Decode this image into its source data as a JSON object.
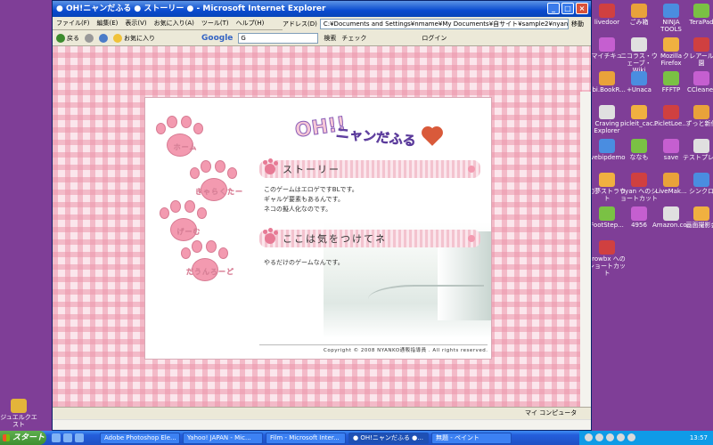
{
  "window": {
    "title": "● OH!ニャンだふる ● ストーリー ● - Microsoft Internet Explorer",
    "buttons": [
      "_",
      "□",
      "×"
    ]
  },
  "menu": [
    "ファイル(F)",
    "編集(E)",
    "表示(V)",
    "お気に入り(A)",
    "ツール(T)",
    "ヘルプ(H)"
  ],
  "address": {
    "label": "アドレス(D)",
    "url": "C:¥Documents and Settings¥nmame¥My Documents¥自サイト¥sample2¥nyan¥story.html",
    "go": "移動"
  },
  "toolbar": {
    "back": "戻る",
    "favorites": "お気に入り",
    "google_logo": "Google",
    "google_value": "G",
    "search": "検索",
    "check": "チェック",
    "login": "ログイン"
  },
  "site": {
    "logo_main": "OH!!",
    "logo_sub": "ニャンだふる",
    "nav": [
      "ホーム",
      "きゃらくたー",
      "げーむ",
      "だうんろーど"
    ],
    "sections": [
      {
        "title": "ストーリー",
        "body": "このゲームはエロゲですBLです。\nギャルゲ要素もあるんです。\nネコの擬人化なのです。"
      },
      {
        "title": "ここは気をつけてネ",
        "body": "やるだけのゲームなんです。"
      }
    ],
    "footer": "Copyright © 2008 NYANKO通販指導員 . All rights reserved."
  },
  "status": {
    "left": "",
    "zone": "マイ コンピュータ"
  },
  "desktop_icons_right": [
    "livedoor",
    "ごみ箱",
    "NINJA TOOLS",
    "TeraPad",
    "マイチキュ",
    "ニコラス・ウェーブ・Wiki",
    "Mozilla Firefox",
    "クレアール学園",
    "ebi.BookR...",
    "+Unaca",
    "FFFTP",
    "CCleaner",
    "Craving Explorer",
    "picleit_cac...",
    "PicletLoe...",
    "ずっと新作",
    "ivebipdemo",
    "ななも",
    "save",
    "テストプレイ",
    "幻夢ストラウト",
    "nyan へのショートカット",
    "LiveMak...",
    "シンクロ",
    "FootStep...",
    "4956",
    "Amazon.co...",
    "画面撮影会",
    "crowbx へのショートカット"
  ],
  "desktop_icons_left": [
    "ジュエルクエスト"
  ],
  "taskbar": {
    "start": "スタート",
    "tasks": [
      "Adobe Photoshop Ele...",
      "Yahoo! JAPAN - Mic...",
      "Film - Microsoft Inter...",
      "● OH!ニャンだふる ●...",
      "無題 - ペイント"
    ],
    "clock": "13:57"
  },
  "colors": {
    "desktop": "#7f3e97",
    "gingham": "#ec96aa",
    "paw": "#f39ab0",
    "titlebar": "#0a4bcf"
  }
}
